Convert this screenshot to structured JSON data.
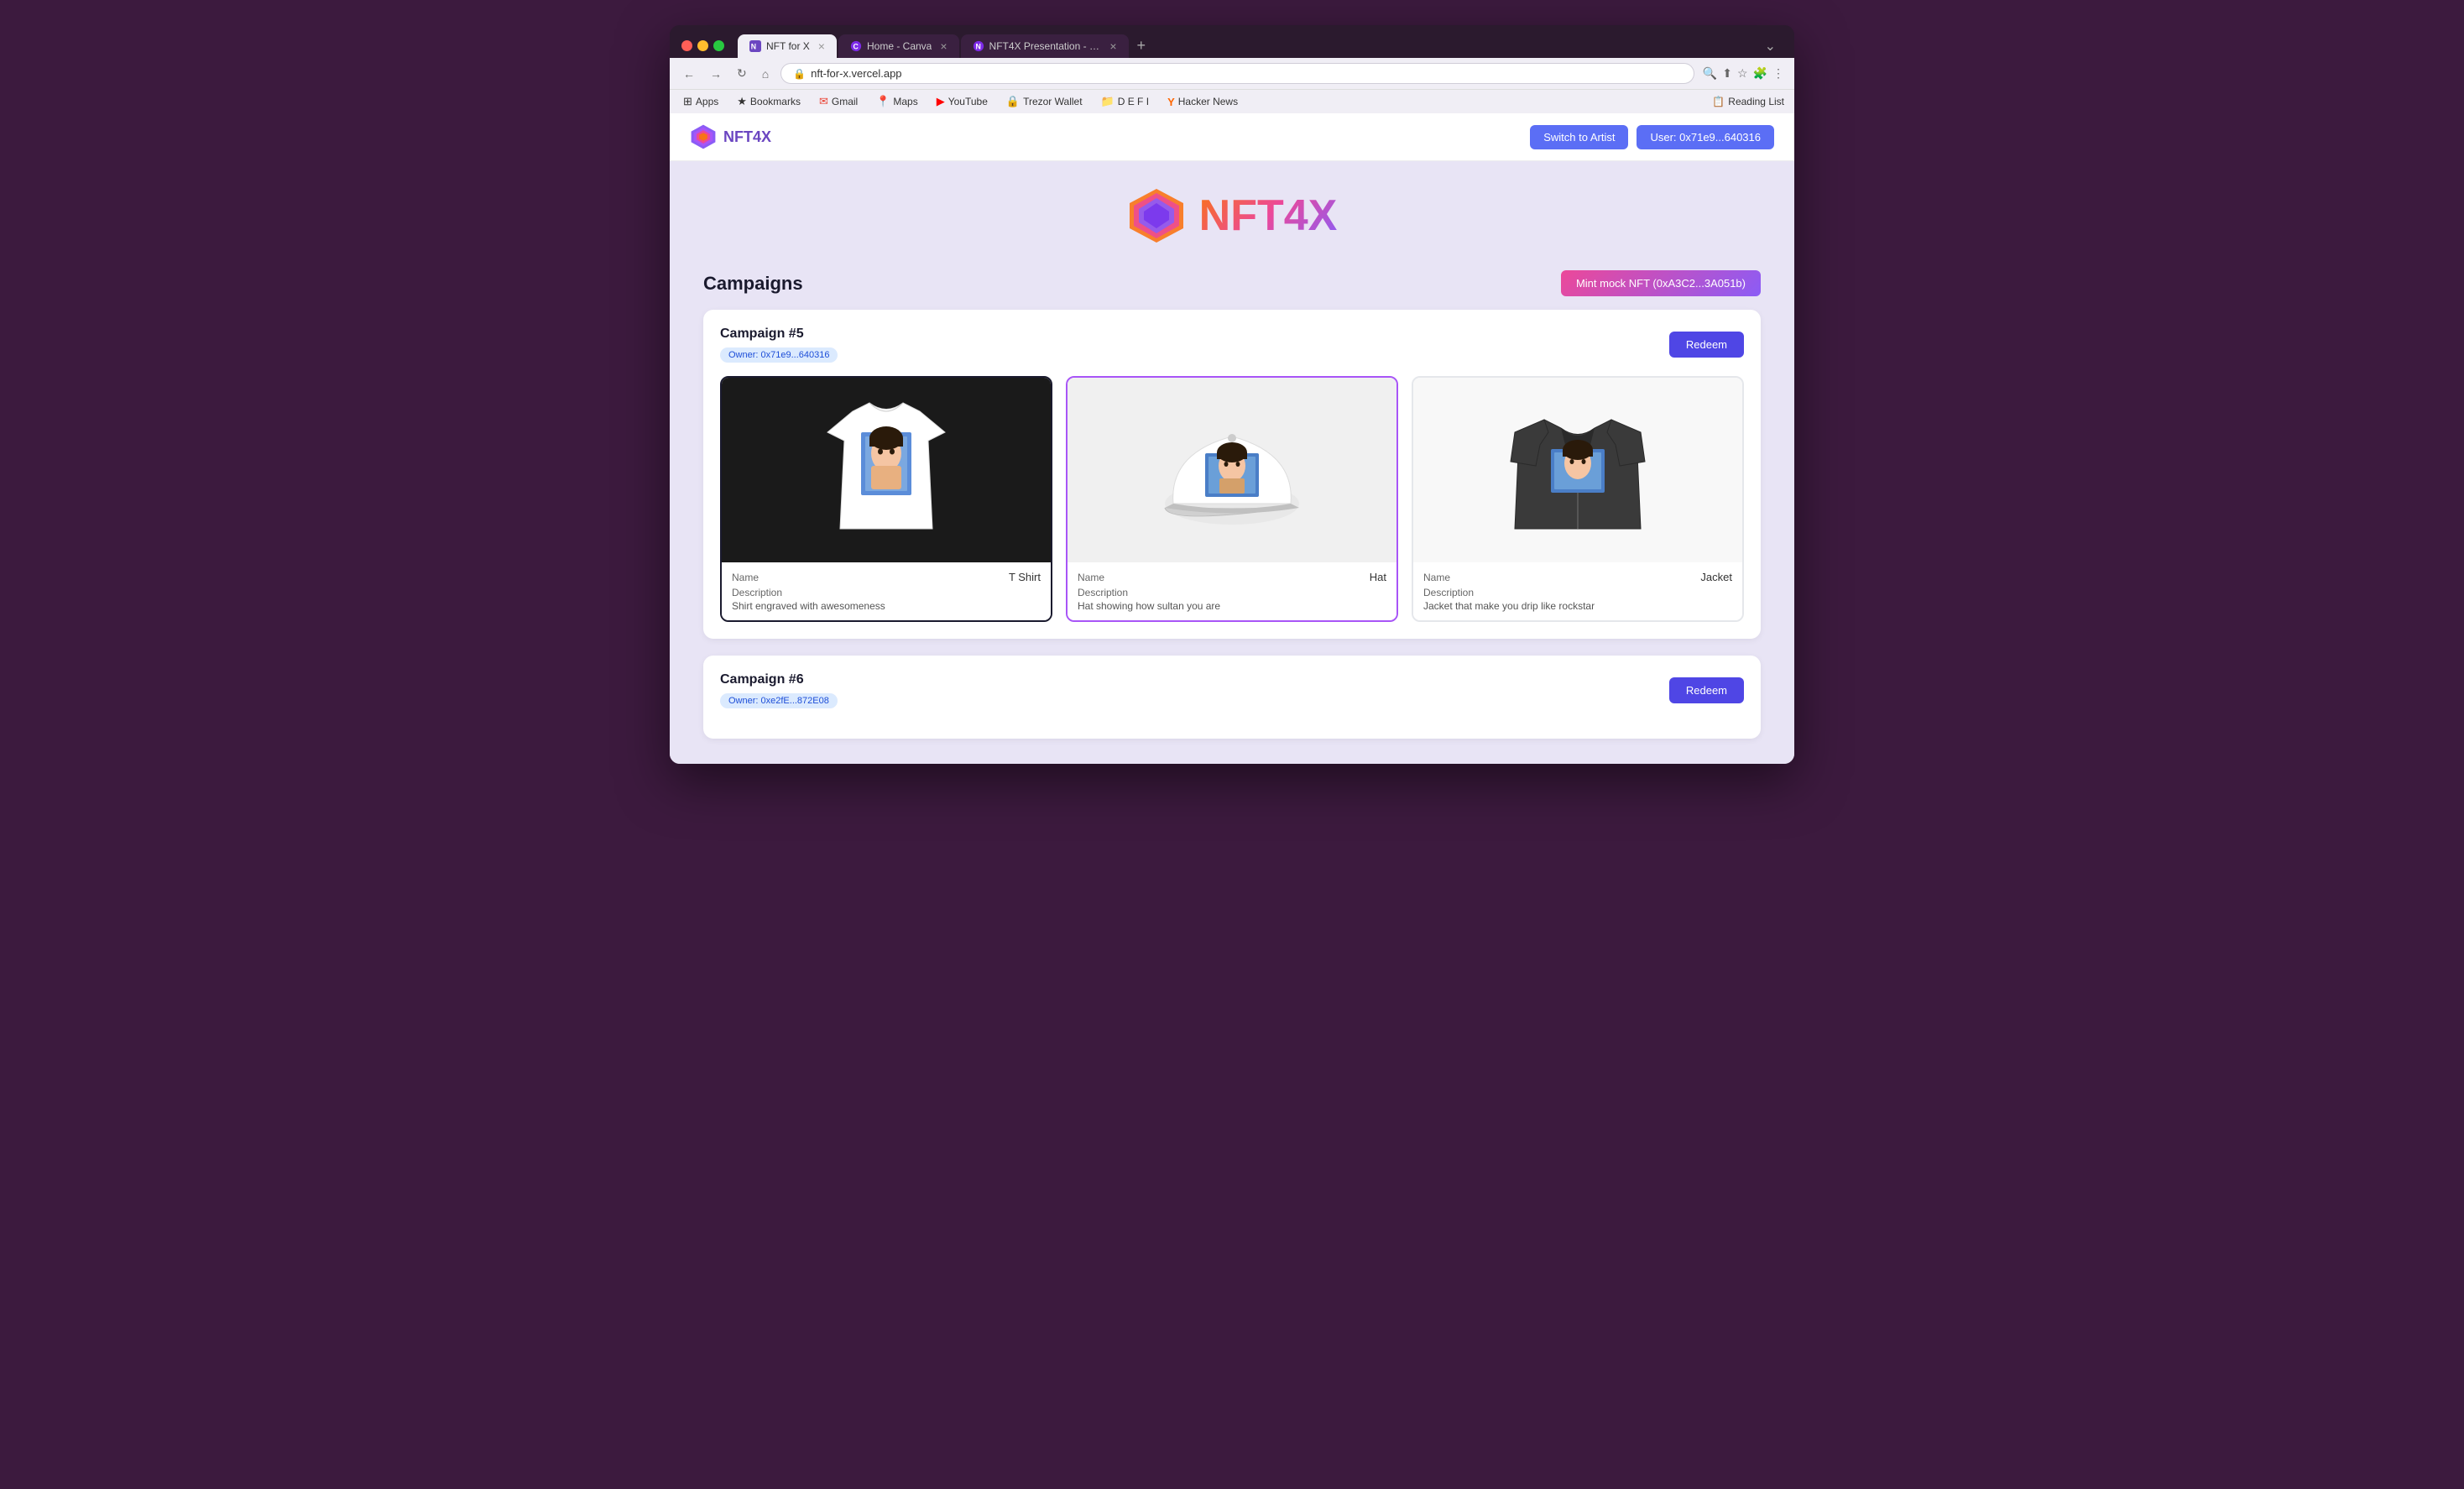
{
  "browser": {
    "tabs": [
      {
        "id": "tab1",
        "label": "NFT for X",
        "active": true,
        "favicon": "nft"
      },
      {
        "id": "tab2",
        "label": "Home - Canva",
        "active": false,
        "favicon": "canva"
      },
      {
        "id": "tab3",
        "label": "NFT4X Presentation - Present...",
        "active": false,
        "favicon": "nft"
      }
    ],
    "address": "nft-for-x.vercel.app",
    "protocol": "https"
  },
  "bookmarks": [
    {
      "label": "Apps",
      "icon": "⊞"
    },
    {
      "label": "Bookmarks",
      "icon": "★"
    },
    {
      "label": "Gmail",
      "icon": "✉"
    },
    {
      "label": "Maps",
      "icon": "📍"
    },
    {
      "label": "YouTube",
      "icon": "▶"
    },
    {
      "label": "Trezor Wallet",
      "icon": "🔒"
    },
    {
      "label": "D E F I",
      "icon": "📁"
    },
    {
      "label": "Hacker News",
      "icon": "Y"
    }
  ],
  "reading_list": "Reading List",
  "app": {
    "logo_text": "NFT4X",
    "switch_button": "Switch to Artist",
    "user_button": "User: 0x71e9...640316"
  },
  "hero": {
    "title": "NFT4X"
  },
  "campaigns": {
    "title": "Campaigns",
    "mint_button": "Mint mock NFT (0xA3C2...3A051b)",
    "campaign5": {
      "name": "Campaign #5",
      "owner": "Owner: 0x71e9...640316",
      "redeem_button": "Redeem",
      "products": [
        {
          "type": "T Shirt",
          "name_label": "Name",
          "desc_label": "Description",
          "description": "Shirt engraved with awesomeness",
          "bg": "dark"
        },
        {
          "type": "Hat",
          "name_label": "Name",
          "desc_label": "Description",
          "description": "Hat showing how sultan you are",
          "bg": "light"
        },
        {
          "type": "Jacket",
          "name_label": "Name",
          "desc_label": "Description",
          "description": "Jacket that make you drip like rockstar",
          "bg": "gray"
        }
      ]
    },
    "campaign6": {
      "name": "Campaign #6",
      "owner": "Owner: 0xe2fE...872E08",
      "redeem_button": "Redeem"
    }
  }
}
